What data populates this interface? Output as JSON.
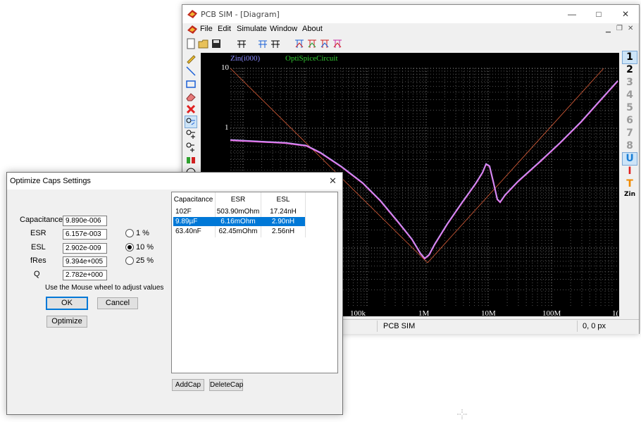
{
  "main_window": {
    "title": "PCB SIM - [Diagram]",
    "menu": [
      "File",
      "Edit",
      "Simulate",
      "Window",
      "About"
    ],
    "status": {
      "middle": "PCB SIM",
      "right": "0, 0 px"
    }
  },
  "plot": {
    "legend_primary": "Zin(i000)",
    "legend_secondary": "OptiSpiceCircuit",
    "y_ticks": [
      "10",
      "1"
    ],
    "x_ticks": [
      "100k",
      "1M",
      "10M",
      "100M",
      "1("
    ],
    "colors": {
      "primary": "#e66fe6",
      "asymptote": "#e0603a",
      "legend_primary": "#8a8aff",
      "legend_secondary": "#33cc33"
    }
  },
  "right_tools": [
    {
      "label": "1",
      "color": "#000000"
    },
    {
      "label": "2",
      "color": "#000000"
    },
    {
      "label": "3",
      "color": "#9a9a9a"
    },
    {
      "label": "4",
      "color": "#9a9a9a"
    },
    {
      "label": "5",
      "color": "#9a9a9a"
    },
    {
      "label": "6",
      "color": "#9a9a9a"
    },
    {
      "label": "7",
      "color": "#9a9a9a"
    },
    {
      "label": "8",
      "color": "#9a9a9a"
    },
    {
      "label": "U",
      "color": "#1a7fd6"
    },
    {
      "label": "I",
      "color": "#e02020"
    },
    {
      "label": "T",
      "color": "#f08a00"
    },
    {
      "label": "Zin",
      "color": "#000000"
    }
  ],
  "dialog": {
    "title": "Optimize Caps Settings",
    "fields": [
      {
        "label": "Capacitance",
        "value": "9.890e-006"
      },
      {
        "label": "ESR",
        "value": "6.157e-003"
      },
      {
        "label": "ESL",
        "value": "2.902e-009"
      },
      {
        "label": "fRes",
        "value": "9.394e+005"
      },
      {
        "label": "Q",
        "value": "2.782e+000"
      }
    ],
    "radios": [
      {
        "label": "1 %",
        "checked": false
      },
      {
        "label": "10 %",
        "checked": true
      },
      {
        "label": "25 %",
        "checked": false
      }
    ],
    "hint": "Use the Mouse wheel to adjust values",
    "ok_label": "OK",
    "cancel_label": "Cancel",
    "optimize_label": "Optimize",
    "add_label": "AddCap",
    "delete_label": "DeleteCap",
    "table": {
      "headers": [
        "Capacitance",
        "ESR",
        "ESL"
      ],
      "rows": [
        [
          "102F",
          "503.90mOhm",
          "17.24nH"
        ],
        [
          "9.89µF",
          "6.16mOhm",
          "2.90nH"
        ],
        [
          "63.40nF",
          "62.45mOhm",
          "2.56nH"
        ]
      ],
      "selected_row": 1
    }
  }
}
